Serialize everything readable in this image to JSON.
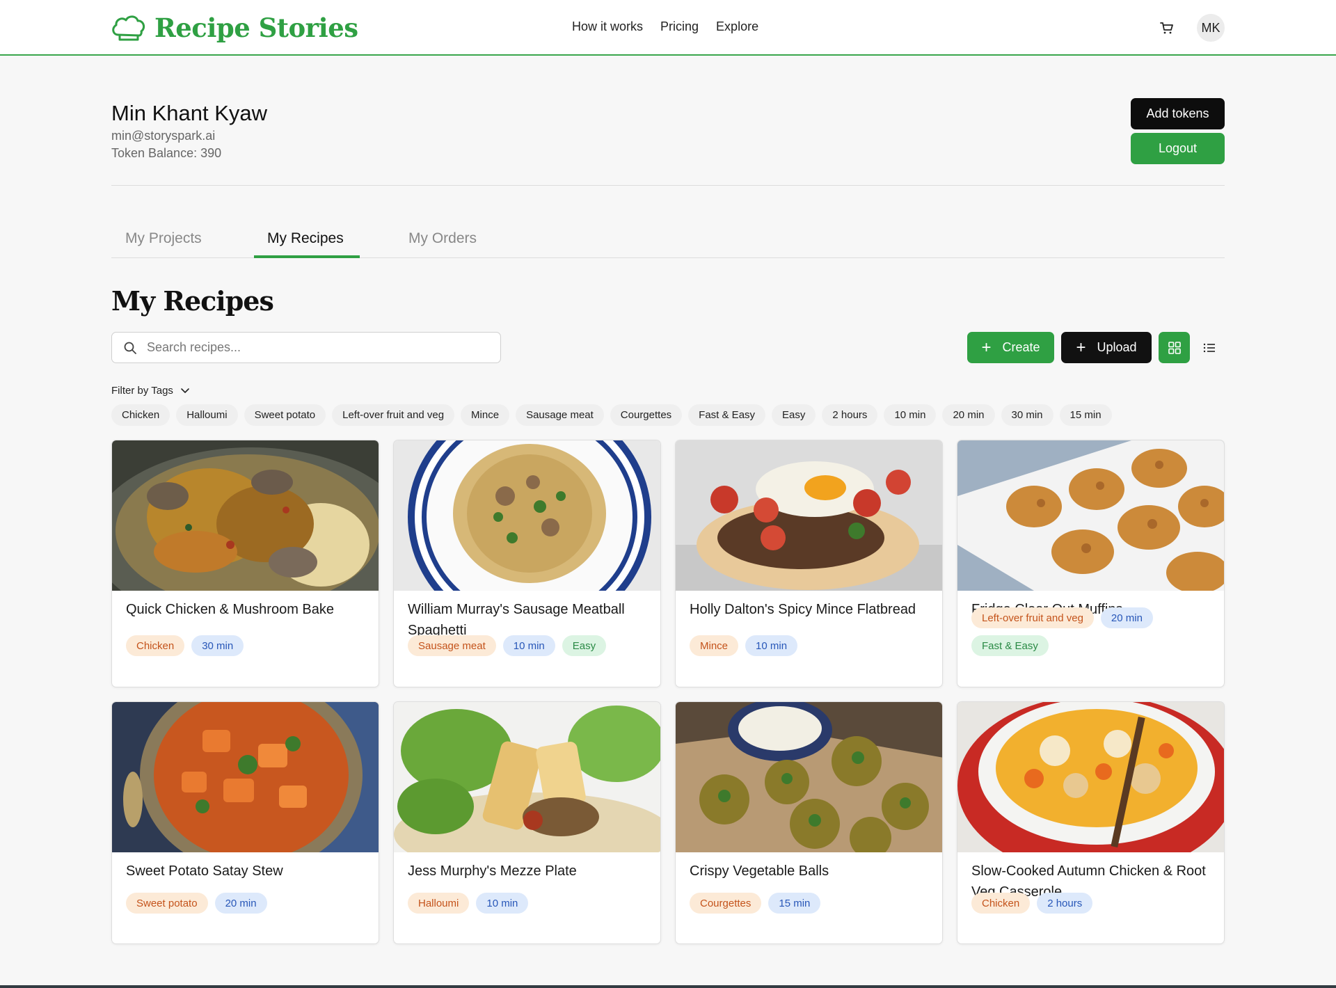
{
  "app": {
    "name": "Recipe Stories"
  },
  "nav": {
    "items": [
      "How it works",
      "Pricing",
      "Explore"
    ]
  },
  "icons": {
    "logo": "chef-hat-icon",
    "cart": "cart-icon",
    "search": "search-icon",
    "grid": "grid-view-icon",
    "list": "list-view-icon",
    "chevron": "chevron-down-icon"
  },
  "user": {
    "initials": "MK",
    "name": "Min Khant Kyaw",
    "email": "min@storyspark.ai",
    "token_balance": "Token Balance: 390"
  },
  "actions": {
    "add_tokens": "Add tokens",
    "logout": "Logout"
  },
  "tabs": [
    {
      "label": "My Projects",
      "active": false
    },
    {
      "label": "My Recipes",
      "active": true
    },
    {
      "label": "My Orders",
      "active": false
    }
  ],
  "section": {
    "title": "My Recipes"
  },
  "search": {
    "placeholder": "Search recipes...",
    "value": ""
  },
  "toolbar": {
    "create_label": "Create",
    "upload_label": "Upload",
    "plus": "+",
    "view_mode": "grid"
  },
  "filter": {
    "label": "Filter by Tags",
    "tags": [
      "Chicken",
      "Halloumi",
      "Sweet potato",
      "Left-over fruit and veg",
      "Mince",
      "Sausage meat",
      "Courgettes",
      "Fast & Easy",
      "Easy",
      "2 hours",
      "10 min",
      "20 min",
      "30 min",
      "15 min"
    ]
  },
  "colors": {
    "brand_green": "#2fa043",
    "ingredient_tag_bg": "#fcead7",
    "ingredient_tag_text": "#c4531b",
    "time_tag_bg": "#dde9fb",
    "time_tag_text": "#2857b8",
    "difficulty_tag_bg": "#dcf4e3",
    "difficulty_tag_text": "#2a8a45"
  },
  "recipes": [
    {
      "title": "Quick Chicken & Mushroom Bake",
      "tags": [
        {
          "label": "Chicken",
          "kind": "ingredient"
        },
        {
          "label": "30 min",
          "kind": "time"
        }
      ]
    },
    {
      "title": "William Murray's Sausage Meatball Spaghetti",
      "tags": [
        {
          "label": "Sausage meat",
          "kind": "ingredient"
        },
        {
          "label": "10 min",
          "kind": "time"
        },
        {
          "label": "Easy",
          "kind": "difficulty"
        }
      ]
    },
    {
      "title": "Holly Dalton's Spicy Mince Flatbread",
      "tags": [
        {
          "label": "Mince",
          "kind": "ingredient"
        },
        {
          "label": "10 min",
          "kind": "time"
        }
      ]
    },
    {
      "title": "Fridge Clear Out Muffins",
      "tags": [
        {
          "label": "Left-over fruit and veg",
          "kind": "ingredient"
        },
        {
          "label": "20 min",
          "kind": "time"
        },
        {
          "label": "Fast & Easy",
          "kind": "difficulty"
        }
      ]
    },
    {
      "title": "Sweet Potato Satay Stew",
      "tags": [
        {
          "label": "Sweet potato",
          "kind": "ingredient"
        },
        {
          "label": "20 min",
          "kind": "time"
        }
      ]
    },
    {
      "title": "Jess Murphy's Mezze Plate",
      "tags": [
        {
          "label": "Halloumi",
          "kind": "ingredient"
        },
        {
          "label": "10 min",
          "kind": "time"
        }
      ]
    },
    {
      "title": "Crispy Vegetable Balls",
      "tags": [
        {
          "label": "Courgettes",
          "kind": "ingredient"
        },
        {
          "label": "15 min",
          "kind": "time"
        }
      ]
    },
    {
      "title": "Slow-Cooked Autumn Chicken & Root Veg Casserole",
      "tags": [
        {
          "label": "Chicken",
          "kind": "ingredient"
        },
        {
          "label": "2 hours",
          "kind": "time"
        }
      ]
    }
  ]
}
